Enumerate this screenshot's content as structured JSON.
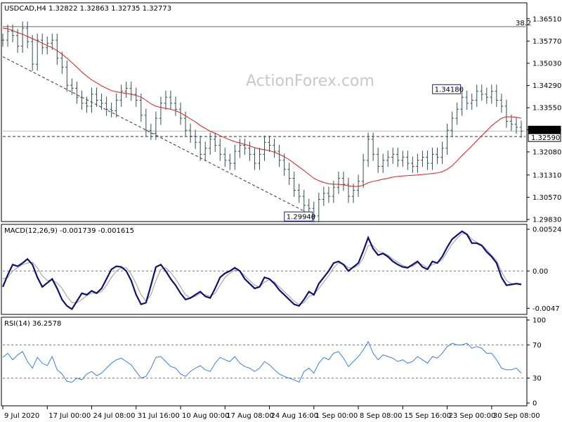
{
  "chart_data": {
    "type": "line",
    "symbol_line": "USDCAD,H4  1.32822 1.32863 1.32735 1.32773",
    "watermark": "ActionForex.com",
    "price": {
      "ylim": [
        1.2983,
        1.3695
      ],
      "ticks": [
        "1.36510",
        "1.35770",
        "1.35030",
        "1.34290",
        "1.33550",
        "1.32820",
        "1.32080",
        "1.31310",
        "1.30570",
        "1.29830"
      ],
      "fib_level": 1.3625,
      "fib_label": "38.2",
      "support_level": 1.3259,
      "support_label": "1.32590",
      "current_price": 1.32773,
      "current_label": "1.32773",
      "annotations": [
        {
          "text": "1.29940",
          "price": 1.2994,
          "bar": 63
        },
        {
          "text": "1.34180",
          "price": 1.3418,
          "bar": 93
        }
      ],
      "trend_line": {
        "bar_start": 0,
        "price_start": 1.3525,
        "bar_end": 63,
        "price_end": 1.2994
      },
      "series": [
        {
          "values": [
            1.358,
            1.361,
            1.3595,
            1.356,
            1.362,
            1.3575,
            1.35,
            1.358,
            1.3555,
            1.357,
            1.358,
            1.352,
            1.349,
            1.343,
            1.342,
            1.339,
            1.337,
            1.336,
            1.34,
            1.338,
            1.337,
            1.335,
            1.3345,
            1.338,
            1.341,
            1.342,
            1.34,
            1.338,
            1.333,
            1.328,
            1.327,
            1.332,
            1.337,
            1.339,
            1.337,
            1.335,
            1.332,
            1.328,
            1.326,
            1.324,
            1.32,
            1.322,
            1.325,
            1.323,
            1.32,
            1.318,
            1.317,
            1.321,
            1.323,
            1.322,
            1.32,
            1.317,
            1.32,
            1.324,
            1.323,
            1.321,
            1.318,
            1.315,
            1.312,
            1.308,
            1.306,
            1.303,
            1.302,
            1.2995,
            1.305,
            1.307,
            1.306,
            1.309,
            1.312,
            1.31,
            1.306,
            1.308,
            1.311,
            1.318,
            1.325,
            1.32,
            1.316,
            1.318,
            1.319,
            1.32,
            1.318,
            1.319,
            1.317,
            1.316,
            1.318,
            1.319,
            1.317,
            1.32,
            1.319,
            1.322,
            1.328,
            1.332,
            1.335,
            1.339,
            1.337,
            1.338,
            1.341,
            1.34,
            1.339,
            1.341,
            1.338,
            1.336,
            1.331,
            1.33,
            1.329,
            1.3277
          ]
        },
        {
          "name": "MA",
          "values": [
            1.362,
            1.3618,
            1.3612,
            1.3605,
            1.36,
            1.3592,
            1.3585,
            1.3578,
            1.357,
            1.3562,
            1.3555,
            1.3545,
            1.3533,
            1.352,
            1.3505,
            1.349,
            1.3474,
            1.346,
            1.3448,
            1.3438,
            1.3428,
            1.342,
            1.3412,
            1.3408,
            1.3405,
            1.3403,
            1.34,
            1.3396,
            1.339,
            1.338,
            1.3368,
            1.336,
            1.3356,
            1.3353,
            1.335,
            1.3345,
            1.3338,
            1.3328,
            1.3318,
            1.3308,
            1.3296,
            1.3286,
            1.3277,
            1.327,
            1.3262,
            1.3255,
            1.3248,
            1.3242,
            1.3238,
            1.3233,
            1.3228,
            1.3222,
            1.3218,
            1.3215,
            1.3212,
            1.3207,
            1.32,
            1.3192,
            1.3182,
            1.317,
            1.3158,
            1.3146,
            1.3133,
            1.312,
            1.3112,
            1.3106,
            1.3102,
            1.31,
            1.31,
            1.3098,
            1.3095,
            1.3093,
            1.3093,
            1.3097,
            1.3105,
            1.311,
            1.3113,
            1.3117,
            1.312,
            1.3124,
            1.3126,
            1.3128,
            1.3129,
            1.313,
            1.3131,
            1.3133,
            1.3134,
            1.3136,
            1.3138,
            1.3142,
            1.315,
            1.3162,
            1.3178,
            1.3196,
            1.3212,
            1.3228,
            1.3245,
            1.3262,
            1.3278,
            1.3295,
            1.3308,
            1.332,
            1.3325,
            1.3325,
            1.3323,
            1.332
          ]
        }
      ]
    },
    "macd": {
      "label": "MACD(12,26,9) -0.001739 -0.001615",
      "ylim": [
        -0.0052,
        0.0056
      ],
      "ticks": [
        "0.005245",
        "0.00",
        "-0.0047"
      ],
      "series": [
        {
          "values": [
            -0.002,
            -0.0005,
            0.0008,
            0.0006,
            0.001,
            0.0015,
            0.0008,
            -0.0008,
            -0.002,
            -0.0015,
            -0.001,
            -0.0022,
            -0.0036,
            -0.0044,
            -0.0048,
            -0.0038,
            -0.0028,
            -0.003,
            -0.0025,
            -0.0028,
            -0.0022,
            -0.001,
            0.0002,
            0.0006,
            0.0005,
            0.0,
            -0.0012,
            -0.003,
            -0.0042,
            -0.004,
            -0.0018,
            0.0005,
            0.0008,
            0.0,
            -0.001,
            -0.0018,
            -0.0028,
            -0.0036,
            -0.0034,
            -0.003,
            -0.0026,
            -0.0032,
            -0.0034,
            -0.0022,
            -0.0008,
            -0.0003,
            0.0,
            0.0004,
            0.0,
            -0.001,
            -0.0016,
            -0.0022,
            -0.002,
            -0.0008,
            -0.001,
            -0.0016,
            -0.0024,
            -0.003,
            -0.0036,
            -0.0042,
            -0.0044,
            -0.0036,
            -0.0026,
            -0.003,
            -0.0016,
            -0.0008,
            0.0,
            0.001,
            0.0012,
            0.0008,
            0.0,
            0.0005,
            0.001,
            0.0025,
            0.0042,
            0.0028,
            0.002,
            0.0022,
            0.0018,
            0.0012,
            0.0008,
            0.0005,
            0.0004,
            0.0008,
            0.0012,
            0.0005,
            0.0002,
            0.0012,
            0.001,
            0.0018,
            0.003,
            0.004,
            0.0045,
            0.005,
            0.0046,
            0.0035,
            0.0035,
            0.0032,
            0.0024,
            0.0018,
            0.001,
            -0.0008,
            -0.0018,
            -0.0017,
            -0.0016,
            -0.0017
          ]
        },
        {
          "name": "signal",
          "values": [
            -0.001,
            -0.0008,
            0.0,
            0.0004,
            0.0008,
            0.001,
            0.0011,
            0.0004,
            -0.0006,
            -0.0012,
            -0.0012,
            -0.0015,
            -0.0022,
            -0.0032,
            -0.004,
            -0.004,
            -0.0036,
            -0.0031,
            -0.0028,
            -0.0028,
            -0.0026,
            -0.0018,
            -0.0008,
            0.0,
            0.0004,
            0.0004,
            -0.0004,
            -0.0016,
            -0.003,
            -0.0038,
            -0.003,
            -0.0012,
            0.0002,
            0.0004,
            -0.0002,
            -0.001,
            -0.002,
            -0.003,
            -0.0034,
            -0.0032,
            -0.0028,
            -0.003,
            -0.0032,
            -0.0028,
            -0.0018,
            -0.0008,
            -0.0003,
            0.0001,
            0.0,
            -0.0006,
            -0.0012,
            -0.0018,
            -0.002,
            -0.0014,
            -0.0011,
            -0.0014,
            -0.002,
            -0.0026,
            -0.0032,
            -0.0038,
            -0.0042,
            -0.004,
            -0.0032,
            -0.003,
            -0.0022,
            -0.0014,
            -0.0006,
            0.0004,
            0.001,
            0.0009,
            0.0004,
            0.0004,
            0.0007,
            0.0016,
            0.0032,
            0.0032,
            0.0025,
            0.0023,
            0.002,
            0.0015,
            0.0011,
            0.0007,
            0.0005,
            0.0006,
            0.001,
            0.0008,
            0.0004,
            0.0008,
            0.001,
            0.0014,
            0.0024,
            0.0034,
            0.0041,
            0.0047,
            0.0047,
            0.004,
            0.0036,
            0.0033,
            0.0027,
            0.002,
            0.0013,
            -0.0001,
            -0.0012,
            -0.0016,
            -0.0016,
            -0.0016
          ]
        }
      ]
    },
    "rsi": {
      "label": "RSI(14) 36.2578",
      "ylim": [
        0,
        100
      ],
      "ticks": [
        "100",
        "70",
        "30",
        "0"
      ],
      "levels": [
        70,
        30
      ],
      "values": [
        55,
        60,
        52,
        58,
        62,
        50,
        42,
        55,
        48,
        45,
        56,
        40,
        35,
        26,
        25,
        30,
        28,
        35,
        38,
        33,
        36,
        42,
        48,
        52,
        54,
        50,
        46,
        38,
        30,
        32,
        42,
        55,
        56,
        50,
        44,
        42,
        35,
        32,
        38,
        42,
        45,
        40,
        38,
        48,
        55,
        52,
        50,
        56,
        48,
        44,
        42,
        38,
        42,
        50,
        46,
        40,
        35,
        32,
        30,
        28,
        25,
        38,
        42,
        36,
        48,
        55,
        52,
        60,
        62,
        54,
        44,
        50,
        56,
        64,
        74,
        60,
        52,
        58,
        56,
        54,
        50,
        52,
        48,
        50,
        56,
        52,
        48,
        56,
        54,
        60,
        68,
        72,
        70,
        70,
        72,
        66,
        68,
        66,
        60,
        60,
        52,
        42,
        40,
        40,
        42,
        36
      ]
    },
    "x_tick_labels": [
      {
        "label": "9 Jul 2020",
        "bar": 0
      },
      {
        "label": "17 Jul 00:00",
        "bar": 9
      },
      {
        "label": "24 Jul 08:00",
        "bar": 18
      },
      {
        "label": "31 Jul 16:00",
        "bar": 27
      },
      {
        "label": "10 Aug 00:00",
        "bar": 36
      },
      {
        "label": "17 Aug 08:00",
        "bar": 45
      },
      {
        "label": "24 Aug 16:00",
        "bar": 54
      },
      {
        "label": "1 Sep 00:00",
        "bar": 63
      },
      {
        "label": "8 Sep 08:00",
        "bar": 72
      },
      {
        "label": "15 Sep 16:00",
        "bar": 81
      },
      {
        "label": "23 Sep 00:00",
        "bar": 90
      },
      {
        "label": "30 Sep 08:00",
        "bar": 99
      }
    ],
    "colors": {
      "price": "#2f4f4f",
      "ma": "#d22020",
      "macd": "#101070",
      "signal": "#9a9a9a",
      "rsi": "#3c7fd8",
      "grid_dash": "#777777"
    }
  }
}
